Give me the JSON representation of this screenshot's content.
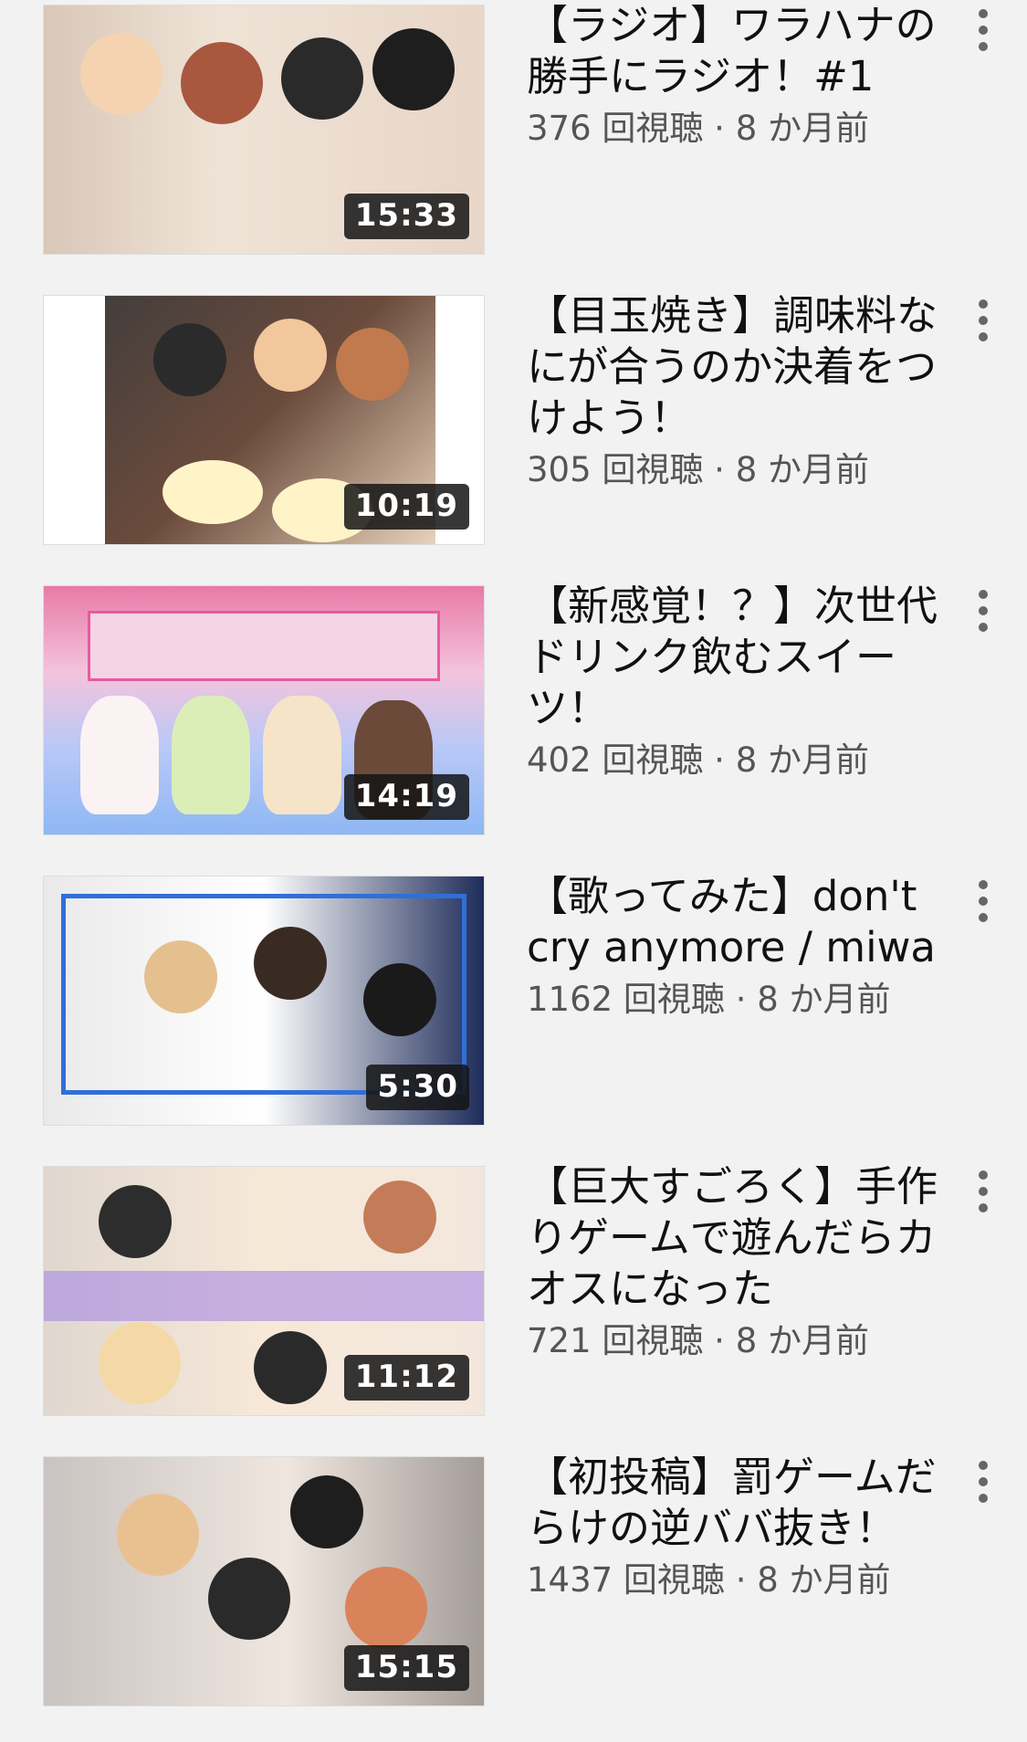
{
  "videos": [
    {
      "title": "【ラジオ】ワラハナの勝手にラジオ！#1",
      "duration": "15:33",
      "views": "376 回視聴",
      "age": "8 か月前"
    },
    {
      "title": "【目玉焼き】調味料なにが合うのか決着をつけよう！",
      "duration": "10:19",
      "views": "305 回視聴",
      "age": "8 か月前"
    },
    {
      "title": "【新感覚！？】次世代ドリンク飲むスイーツ！",
      "duration": "14:19",
      "views": "402 回視聴",
      "age": "8 か月前"
    },
    {
      "title": "【歌ってみた】don't cry anymore / miwa",
      "duration": "5:30",
      "views": "1162 回視聴",
      "age": "8 か月前"
    },
    {
      "title": "【巨大すごろく】手作りゲームで遊んだらカオスになった",
      "duration": "11:12",
      "views": "721 回視聴",
      "age": "8 か月前"
    },
    {
      "title": "【初投稿】罰ゲームだらけの逆ババ抜き！",
      "duration": "15:15",
      "views": "1437 回視聴",
      "age": "8 か月前"
    }
  ],
  "stats_separator": " · ",
  "icons": {
    "more": "more-vert-icon"
  }
}
